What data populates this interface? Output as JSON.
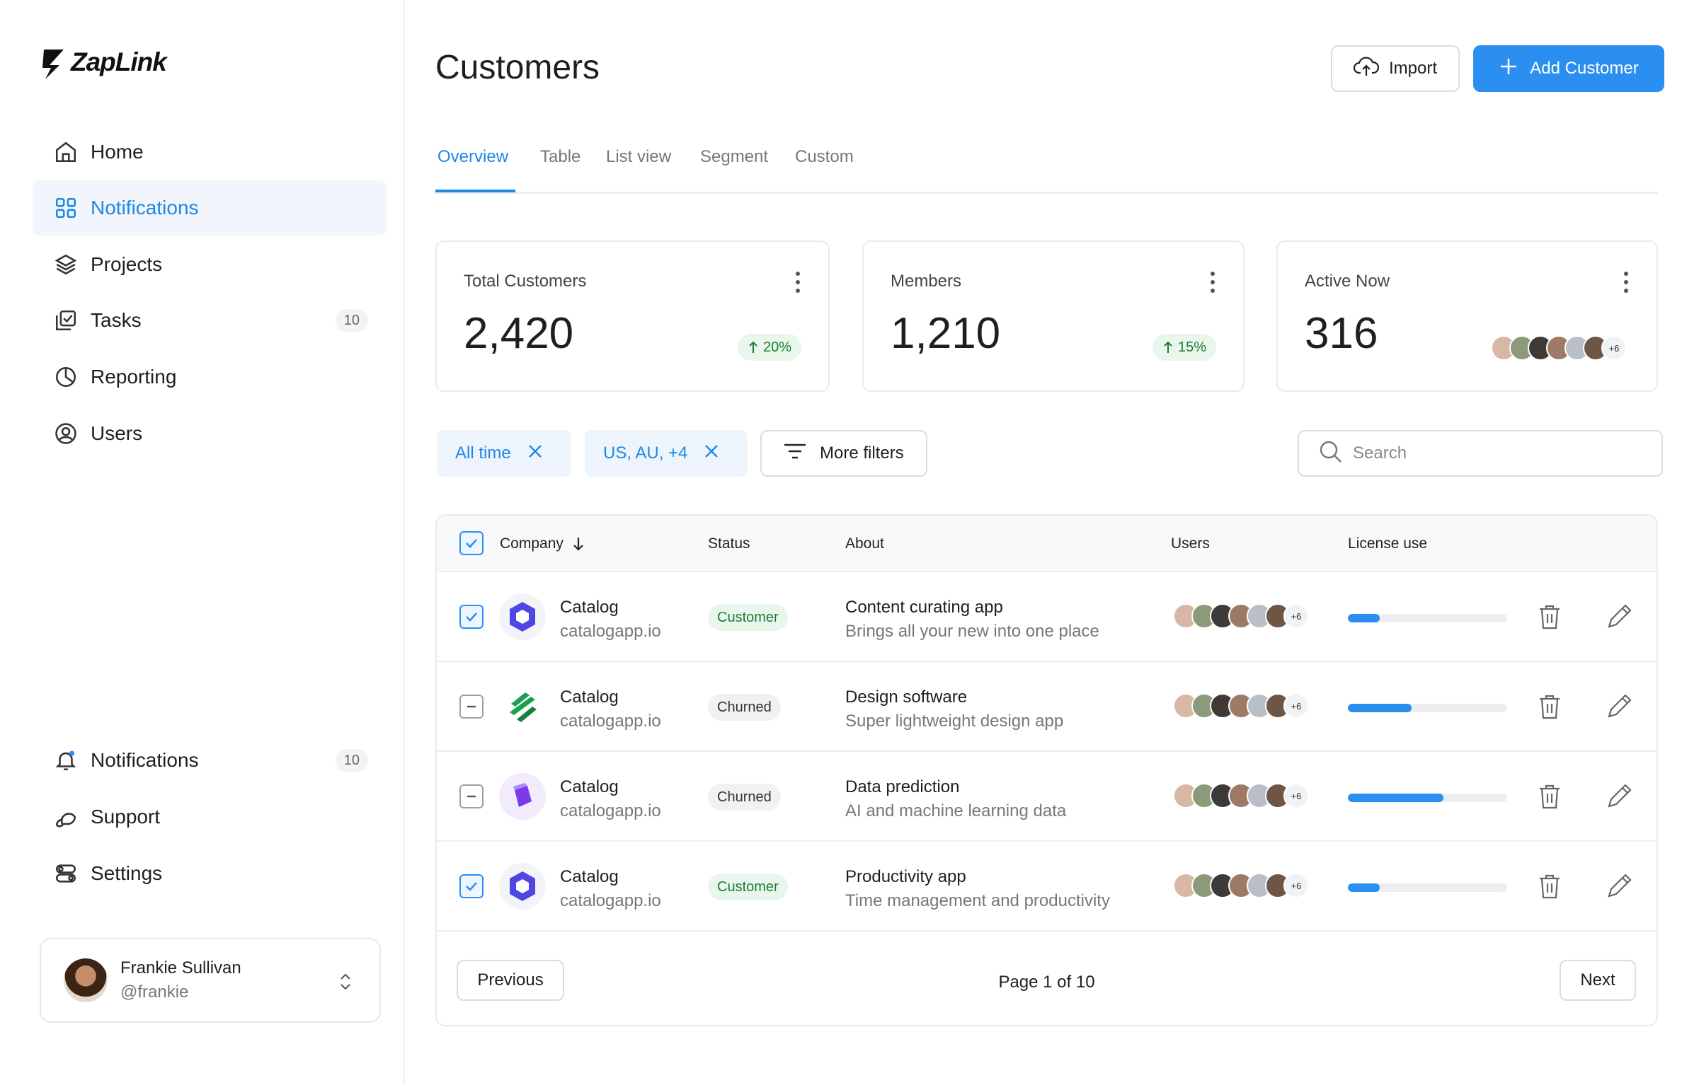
{
  "brand": {
    "name": "ZapLink",
    "accent": "#1e88e5",
    "button_blue": "#2a8ff0"
  },
  "sidebar": {
    "items": [
      {
        "label": "Home",
        "icon": "home-icon"
      },
      {
        "label": "Notifications",
        "icon": "grid-icon",
        "active": true
      },
      {
        "label": "Projects",
        "icon": "layers-icon"
      },
      {
        "label": "Tasks",
        "icon": "tasks-icon",
        "count": "10"
      },
      {
        "label": "Reporting",
        "icon": "pie-chart-icon"
      },
      {
        "label": "Users",
        "icon": "user-circle-icon"
      }
    ],
    "bottom_items": [
      {
        "label": "Notifications",
        "icon": "bell-icon",
        "count": "10"
      },
      {
        "label": "Support",
        "icon": "support-icon"
      },
      {
        "label": "Settings",
        "icon": "settings-icon"
      }
    ],
    "user": {
      "name": "Frankie Sullivan",
      "handle": "@frankie"
    }
  },
  "header": {
    "title": "Customers",
    "import_label": "Import",
    "add_label": "Add Customer"
  },
  "tabs": [
    "Overview",
    "Table",
    "List view",
    "Segment",
    "Custom"
  ],
  "stats": [
    {
      "label": "Total Customers",
      "value": "2,420",
      "trend": "20%"
    },
    {
      "label": "Members",
      "value": "1,210",
      "trend": "15%"
    },
    {
      "label": "Active Now",
      "value": "316",
      "avatars_more": "+6"
    }
  ],
  "filters": {
    "chips": [
      "All time",
      "US, AU, +4"
    ],
    "more_label": "More filters",
    "search_placeholder": "Search"
  },
  "table": {
    "headers": {
      "company": "Company",
      "status": "Status",
      "about": "About",
      "users": "Users",
      "license": "License use"
    },
    "rows": [
      {
        "name": "Catalog",
        "domain": "catalogapp.io",
        "status": "Customer",
        "about_title": "Content curating app",
        "about_sub": "Brings all your new into one place",
        "users_more": "+6",
        "license": 0.2,
        "checked": true,
        "logo": "catalog-logo-icon"
      },
      {
        "name": "Catalog",
        "domain": "catalogapp.io",
        "status": "Churned",
        "about_title": "Design software",
        "about_sub": "Super lightweight design app",
        "users_more": "+6",
        "license": 0.4,
        "checked": false,
        "logo": "green-stripes-logo-icon"
      },
      {
        "name": "Catalog",
        "domain": "catalogapp.io",
        "status": "Churned",
        "about_title": "Data prediction",
        "about_sub": "AI and machine learning data",
        "users_more": "+6",
        "license": 0.6,
        "checked": false,
        "logo": "purple-cube-logo-icon"
      },
      {
        "name": "Catalog",
        "domain": "catalogapp.io",
        "status": "Customer",
        "about_title": "Productivity app",
        "about_sub": "Time management and productivity",
        "users_more": "+6",
        "license": 0.2,
        "checked": true,
        "logo": "catalog-logo-icon"
      }
    ],
    "pagination": {
      "previous": "Previous",
      "info": "Page 1 of 10",
      "next": "Next"
    }
  }
}
